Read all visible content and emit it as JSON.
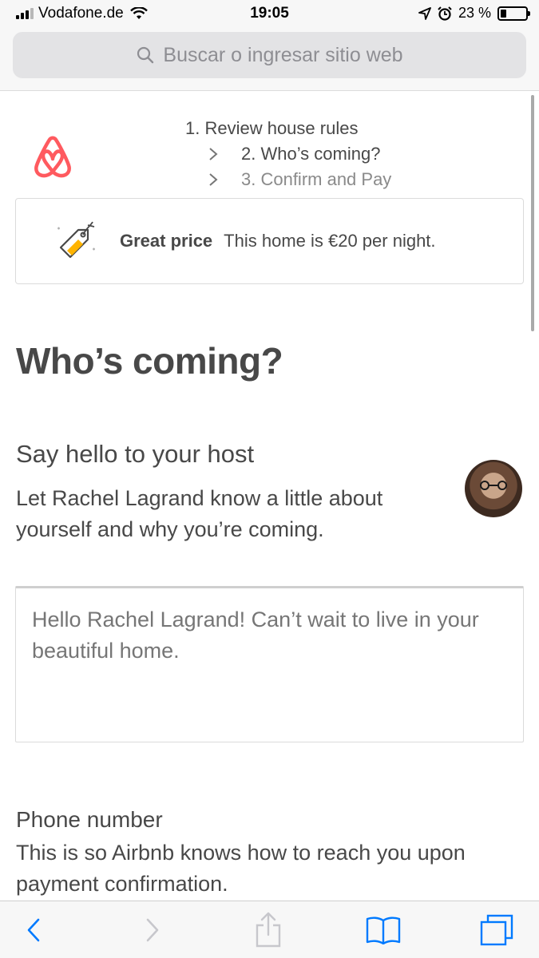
{
  "status_bar": {
    "carrier": "Vodafone.de",
    "time": "19:05",
    "battery": "23 %",
    "battery_level": 0.23
  },
  "browser": {
    "search_placeholder": "Buscar o ingresar sitio web"
  },
  "steps": {
    "step1": "1. Review house rules",
    "step2": "2. Who’s coming?",
    "step3": "3. Confirm and Pay"
  },
  "price_banner": {
    "label": "Great price",
    "text": "This home is €20 per night."
  },
  "page_title": "Who’s coming?",
  "host_section": {
    "title": "Say hello to your host",
    "description": "Let Rachel Lagrand know a little about yourself and why you’re coming.",
    "message_placeholder": "Hello Rachel Lagrand! Can’t wait to live in your beautiful home."
  },
  "phone_section": {
    "title": "Phone number",
    "description": "This is so Airbnb knows how to reach you upon payment confirmation."
  },
  "colors": {
    "brand": "#ff5a5f",
    "ios_blue": "#007aff",
    "text": "#484848",
    "tag_yellow": "#ffb400"
  },
  "icons": [
    "signal-icon",
    "wifi-icon",
    "location-icon",
    "alarm-icon",
    "battery-icon",
    "search-icon",
    "airbnb-logo-icon",
    "chevron-right-icon",
    "price-tag-icon",
    "back-icon",
    "forward-icon",
    "share-icon",
    "bookmarks-icon",
    "tabs-icon"
  ]
}
